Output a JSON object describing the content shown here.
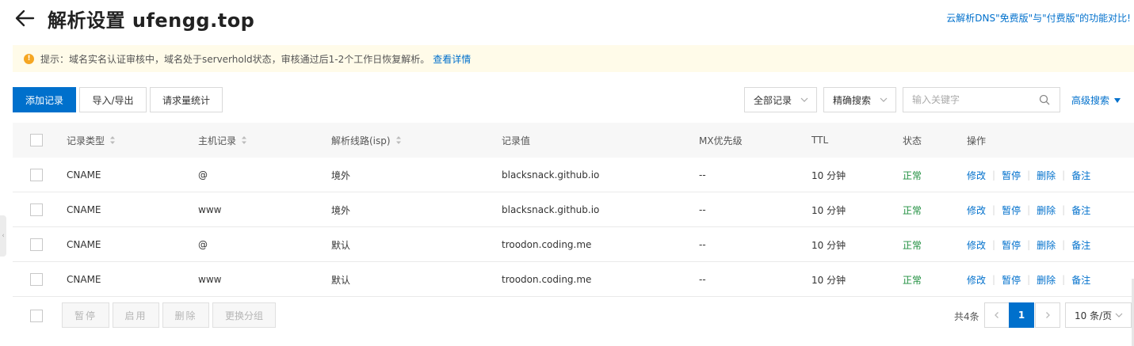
{
  "header": {
    "title": "解析设置 ufengg.top",
    "compare_link": "云解析DNS\"免费版\"与\"付费版\"的功能对比!"
  },
  "notice": {
    "text": "提示：域名实名认证审核中，域名处于serverhold状态，审核通过后1-2个工作日恢复解析。",
    "link": "查看详情"
  },
  "toolbar": {
    "add_record": "添加记录",
    "import_export": "导入/导出",
    "request_stats": "请求量统计",
    "record_filter": "全部记录",
    "search_mode": "精确搜索",
    "search_placeholder": "输入关键字",
    "advanced_search": "高级搜索"
  },
  "table": {
    "headers": {
      "type": "记录类型",
      "host": "主机记录",
      "line": "解析线路(isp)",
      "value": "记录值",
      "mx": "MX优先级",
      "ttl": "TTL",
      "status": "状态",
      "ops": "操作"
    },
    "rows": [
      {
        "type": "CNAME",
        "host": "@",
        "line": "境外",
        "value": "blacksnack.github.io",
        "mx": "--",
        "ttl": "10 分钟",
        "status": "正常"
      },
      {
        "type": "CNAME",
        "host": "www",
        "line": "境外",
        "value": "blacksnack.github.io",
        "mx": "--",
        "ttl": "10 分钟",
        "status": "正常"
      },
      {
        "type": "CNAME",
        "host": "@",
        "line": "默认",
        "value": "troodon.coding.me",
        "mx": "--",
        "ttl": "10 分钟",
        "status": "正常"
      },
      {
        "type": "CNAME",
        "host": "www",
        "line": "默认",
        "value": "troodon.coding.me",
        "mx": "--",
        "ttl": "10 分钟",
        "status": "正常"
      }
    ],
    "ops": {
      "edit": "修改",
      "pause": "暂停",
      "delete": "删除",
      "note": "备注"
    }
  },
  "footer": {
    "pause": "暂停",
    "enable": "启用",
    "delete": "删除",
    "change_group": "更换分组",
    "total": "共4条",
    "current_page": "1",
    "page_size": "10 条/页"
  },
  "colors": {
    "primary": "#0070cc",
    "status_ok": "#1e8e3e",
    "notice_bg": "#fffbe9",
    "warning_icon": "#f5a623"
  }
}
